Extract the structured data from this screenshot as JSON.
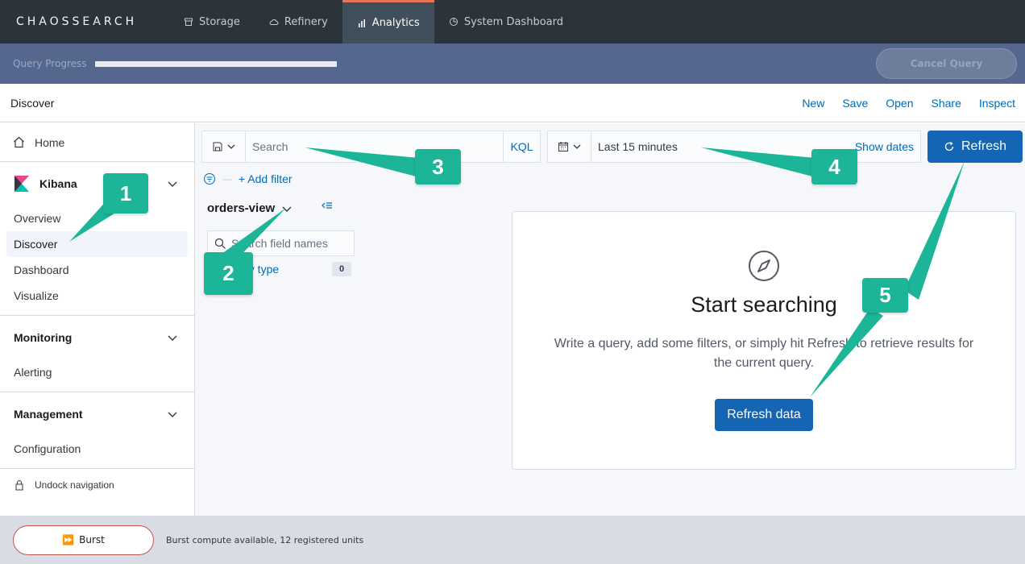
{
  "brand": {
    "logo_text": "CHAOSSEARCH"
  },
  "topnav": {
    "tabs": [
      {
        "label": "Storage",
        "icon": "storage-icon"
      },
      {
        "label": "Refinery",
        "icon": "cloud-icon"
      },
      {
        "label": "Analytics",
        "icon": "bar-chart-icon",
        "active": true
      },
      {
        "label": "System Dashboard",
        "icon": "dashboard-icon"
      }
    ]
  },
  "query_progress": {
    "label": "Query Progress",
    "progress_fraction": 1.0,
    "cancel_label": "Cancel Query"
  },
  "header": {
    "title": "Discover",
    "links": [
      "New",
      "Save",
      "Open",
      "Share",
      "Inspect"
    ]
  },
  "sidebar": {
    "home_label": "Home",
    "kibana": {
      "title": "Kibana",
      "items": [
        "Overview",
        "Discover",
        "Dashboard",
        "Visualize"
      ],
      "selected": "Discover"
    },
    "monitoring": {
      "title": "Monitoring",
      "items": [
        "Alerting"
      ]
    },
    "management": {
      "title": "Management",
      "items": [
        "Configuration"
      ]
    },
    "undock_label": "Undock navigation"
  },
  "search": {
    "placeholder": "Search",
    "language": "KQL"
  },
  "date": {
    "range": "Last 15 minutes",
    "show_dates": "Show dates"
  },
  "refresh_label": "Refresh",
  "filters": {
    "add_filter": "+ Add filter"
  },
  "index_pattern": {
    "name": "orders-view"
  },
  "field_search": {
    "placeholder": "Search field names",
    "filter_by_type": "Filter by type",
    "count": "0"
  },
  "empty_state": {
    "title": "Start searching",
    "text": "Write a query, add some filters, or simply hit Refresh to retrieve results for the current query.",
    "button": "Refresh data"
  },
  "footer": {
    "burst_label": "Burst",
    "info": "Burst compute available, 12 registered units"
  },
  "callouts": [
    "1",
    "2",
    "3",
    "4",
    "5"
  ],
  "colors": {
    "accent_blue": "#1565b5",
    "callout_teal": "#1db597",
    "active_tab_border": "#e87557"
  }
}
